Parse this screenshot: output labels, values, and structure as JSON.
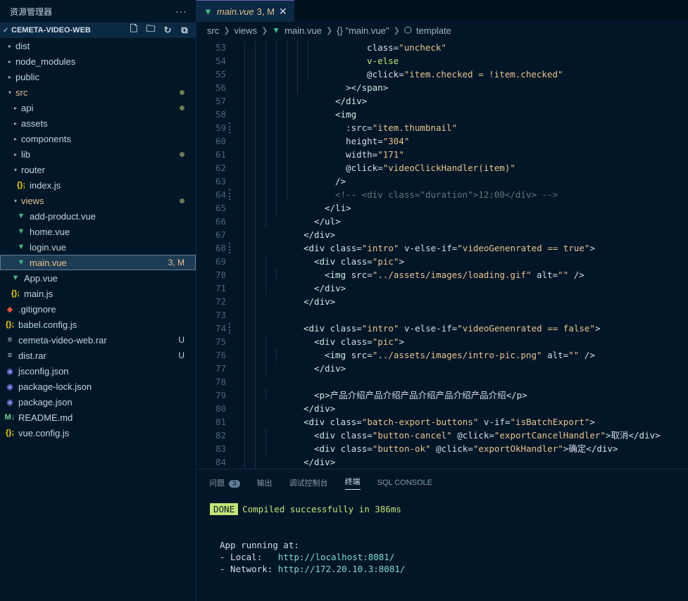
{
  "sidebar": {
    "title": "资源管理器",
    "more": "···",
    "project": "CEMETA-VIDEO-WEB",
    "items": [
      {
        "label": "dist",
        "arrow": "▸",
        "icon": "",
        "indent": 0
      },
      {
        "label": "node_modules",
        "arrow": "▸",
        "icon": "",
        "indent": 0
      },
      {
        "label": "public",
        "arrow": "▸",
        "icon": "",
        "indent": 0
      },
      {
        "label": "src",
        "arrow": "▾",
        "icon": "",
        "indent": 0
      },
      {
        "label": "api",
        "arrow": "▸",
        "icon": "",
        "indent": 1
      },
      {
        "label": "assets",
        "arrow": "▸",
        "icon": "",
        "indent": 1
      },
      {
        "label": "components",
        "arrow": "▸",
        "icon": "",
        "indent": 1
      },
      {
        "label": "lib",
        "arrow": "▸",
        "icon": "",
        "indent": 1
      },
      {
        "label": "router",
        "arrow": "▾",
        "icon": "",
        "indent": 1
      },
      {
        "label": "index.js",
        "arrow": "",
        "icon": "{};",
        "indent": 2
      },
      {
        "label": "views",
        "arrow": "▾",
        "icon": "",
        "indent": 1
      },
      {
        "label": "add-product.vue",
        "arrow": "",
        "icon": "▼",
        "indent": 2
      },
      {
        "label": "home.vue",
        "arrow": "",
        "icon": "▼",
        "indent": 2
      },
      {
        "label": "login.vue",
        "arrow": "",
        "icon": "▼",
        "indent": 2
      },
      {
        "label": "main.vue",
        "arrow": "",
        "icon": "▼",
        "indent": 2,
        "badge": "3, M"
      },
      {
        "label": "App.vue",
        "arrow": "",
        "icon": "▼",
        "indent": 1
      },
      {
        "label": "main.js",
        "arrow": "",
        "icon": "{};",
        "indent": 1
      },
      {
        "label": ".gitignore",
        "arrow": "",
        "icon": "◆",
        "indent": 0
      },
      {
        "label": "babel.config.js",
        "arrow": "",
        "icon": "{};",
        "indent": 0
      },
      {
        "label": "cemeta-video-web.rar",
        "arrow": "",
        "icon": "≡",
        "indent": 0,
        "badge": "U"
      },
      {
        "label": "dist.rar",
        "arrow": "",
        "icon": "≡",
        "indent": 0,
        "badge": "U"
      },
      {
        "label": "jsconfig.json",
        "arrow": "",
        "icon": "◉",
        "indent": 0
      },
      {
        "label": "package-lock.json",
        "arrow": "",
        "icon": "◉",
        "indent": 0
      },
      {
        "label": "package.json",
        "arrow": "",
        "icon": "◉",
        "indent": 0
      },
      {
        "label": "README.md",
        "arrow": "",
        "icon": "M↓",
        "indent": 0
      },
      {
        "label": "vue.config.js",
        "arrow": "",
        "icon": "{};",
        "indent": 0
      }
    ]
  },
  "editor": {
    "tab": {
      "name": "main.vue",
      "status": "3, M",
      "close": "✕"
    },
    "breadcrumb": [
      "src",
      "views",
      "main.vue",
      "{} \"main.vue\"",
      "template"
    ],
    "lines": [
      {
        "n": "53",
        "mod": false,
        "depth": 5,
        "code": "  class=\"uncheck\""
      },
      {
        "n": "54",
        "mod": false,
        "depth": 5,
        "code": "  v-else"
      },
      {
        "n": "55",
        "mod": false,
        "depth": 5,
        "code": "  @click=\"item.checked = !item.checked\""
      },
      {
        "n": "56",
        "mod": false,
        "depth": 4,
        "code": "></span>"
      },
      {
        "n": "57",
        "mod": false,
        "depth": 3,
        "code": "</div>"
      },
      {
        "n": "58",
        "mod": false,
        "depth": 3,
        "code": "<img"
      },
      {
        "n": "59",
        "mod": true,
        "depth": 3,
        "code": "  :src=\"item.thumbnail\""
      },
      {
        "n": "60",
        "mod": false,
        "depth": 3,
        "code": "  height=\"304\""
      },
      {
        "n": "61",
        "mod": false,
        "depth": 3,
        "code": "  width=\"171\""
      },
      {
        "n": "62",
        "mod": false,
        "depth": 3,
        "code": "  @click=\"videoClickHandler(item)\""
      },
      {
        "n": "63",
        "mod": false,
        "depth": 3,
        "code": "/>"
      },
      {
        "n": "64",
        "mod": true,
        "depth": 3,
        "code": "<!-- <div class=\"duration\">12:00</div> -->"
      },
      {
        "n": "65",
        "mod": false,
        "depth": 2,
        "code": "</li>"
      },
      {
        "n": "66",
        "mod": false,
        "depth": 1,
        "code": "</ul>"
      },
      {
        "n": "67",
        "mod": false,
        "depth": 0,
        "code": "</div>"
      },
      {
        "n": "68",
        "mod": true,
        "depth": 0,
        "code": "<div class=\"intro\" v-else-if=\"videoGenenrated == true\">"
      },
      {
        "n": "69",
        "mod": false,
        "depth": 1,
        "code": "<div class=\"pic\">"
      },
      {
        "n": "70",
        "mod": false,
        "depth": 2,
        "code": "<img src=\"../assets/images/loading.gif\" alt=\"\" />"
      },
      {
        "n": "71",
        "mod": false,
        "depth": 1,
        "code": "</div>"
      },
      {
        "n": "72",
        "mod": false,
        "depth": 0,
        "code": "</div>"
      },
      {
        "n": "73",
        "mod": false,
        "depth": 0,
        "code": ""
      },
      {
        "n": "74",
        "mod": true,
        "depth": 0,
        "code": "<div class=\"intro\" v-else-if=\"videoGenenrated == false\">"
      },
      {
        "n": "75",
        "mod": false,
        "depth": 1,
        "code": "<div class=\"pic\">"
      },
      {
        "n": "76",
        "mod": false,
        "depth": 2,
        "code": "<img src=\"../assets/images/intro-pic.png\" alt=\"\" />"
      },
      {
        "n": "77",
        "mod": false,
        "depth": 1,
        "code": "</div>"
      },
      {
        "n": "78",
        "mod": false,
        "depth": 0,
        "code": ""
      },
      {
        "n": "79",
        "mod": false,
        "depth": 1,
        "code": "<p>产品介绍产品介绍产品介绍产品介绍产品介绍</p>"
      },
      {
        "n": "80",
        "mod": false,
        "depth": 0,
        "code": "</div>"
      },
      {
        "n": "81",
        "mod": false,
        "depth": 0,
        "code": "<div class=\"batch-export-buttons\" v-if=\"isBatchExport\">"
      },
      {
        "n": "82",
        "mod": false,
        "depth": 1,
        "code": "<div class=\"button-cancel\" @click=\"exportCancelHandler\">取消</div>"
      },
      {
        "n": "83",
        "mod": false,
        "depth": 1,
        "code": "<div class=\"button-ok\" @click=\"exportOkHandler\">确定</div>"
      },
      {
        "n": "84",
        "mod": false,
        "depth": 0,
        "code": "</div>"
      }
    ]
  },
  "panel": {
    "tabs": [
      {
        "label": "问题",
        "count": "3"
      },
      {
        "label": "输出"
      },
      {
        "label": "调试控制台"
      },
      {
        "label": "终端",
        "active": true
      },
      {
        "label": "SQL CONSOLE"
      }
    ],
    "done_badge": "DONE",
    "compiled": "Compiled successfully in 386ms",
    "app_running": "App running at:",
    "local_label": "- Local:   ",
    "local_url": "http://localhost:8081/",
    "network_label": "- Network: ",
    "network_url": "http://172.20.10.3:8081/"
  },
  "colors": {
    "accent": "#7e57c2",
    "background": "#011627",
    "vue": "#41b883",
    "string": "#ecc48d",
    "attr": "#c5e478"
  }
}
